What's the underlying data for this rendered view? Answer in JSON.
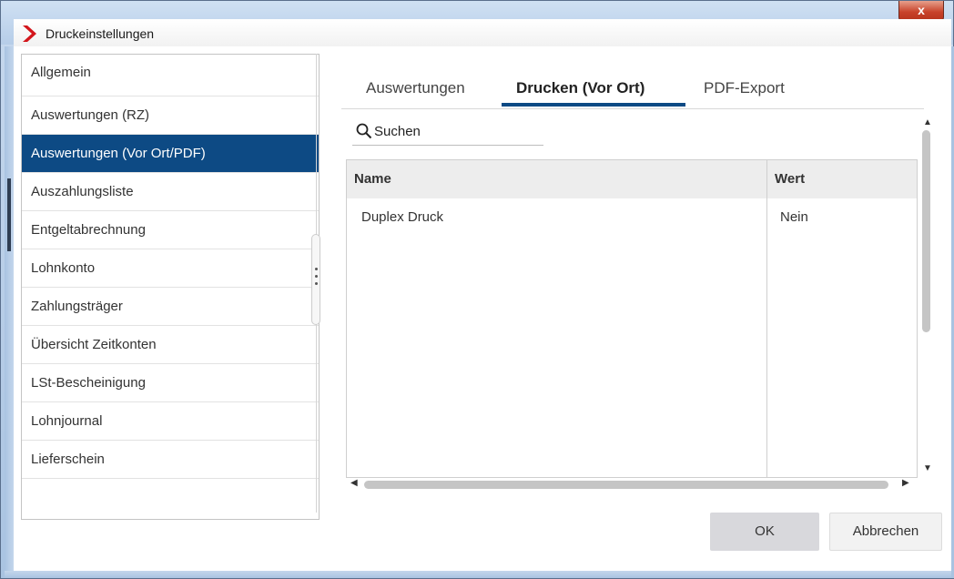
{
  "window": {
    "title": "Druckeinstellungen",
    "close_label": "x",
    "accent_color": "#0d4a84",
    "logo_color": "#d3161c"
  },
  "sidebar": {
    "items": [
      {
        "label": "Allgemein"
      },
      {
        "label": "Auswertungen (RZ)"
      },
      {
        "label": "Auswertungen (Vor Ort/PDF)",
        "selected": true
      },
      {
        "label": "Auszahlungsliste"
      },
      {
        "label": "Entgeltabrechnung"
      },
      {
        "label": "Lohnkonto"
      },
      {
        "label": "Zahlungsträger"
      },
      {
        "label": "Übersicht Zeitkonten"
      },
      {
        "label": "LSt-Bescheinigung"
      },
      {
        "label": "Lohnjournal"
      },
      {
        "label": "Lieferschein"
      }
    ]
  },
  "tabs": [
    {
      "label": "Auswertungen"
    },
    {
      "label": "Drucken (Vor Ort)",
      "active": true
    },
    {
      "label": "PDF-Export"
    }
  ],
  "search": {
    "label": "Suchen"
  },
  "table": {
    "columns": [
      "Name",
      "Wert"
    ],
    "rows": [
      {
        "name": "Duplex Druck",
        "wert": "Nein"
      }
    ]
  },
  "buttons": {
    "ok": "OK",
    "cancel": "Abbrechen"
  }
}
